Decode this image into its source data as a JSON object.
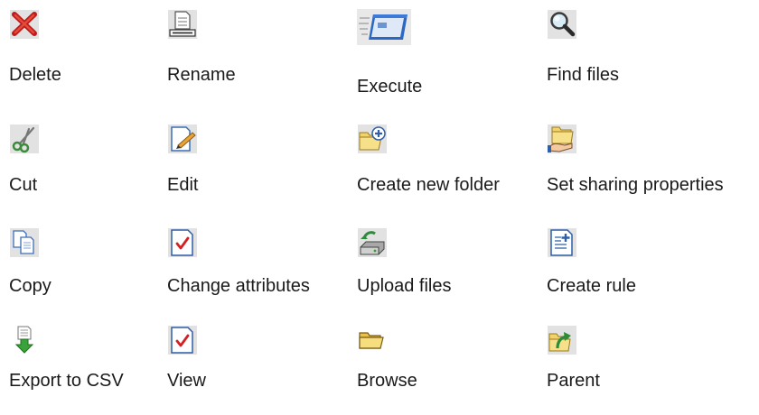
{
  "actions": [
    {
      "label": "Delete",
      "icon": "delete-x-icon"
    },
    {
      "label": "Rename",
      "icon": "rename-document-icon"
    },
    {
      "label": "Execute",
      "icon": "execute-window-icon"
    },
    {
      "label": "Find files",
      "icon": "magnifier-icon"
    },
    {
      "label": "Cut",
      "icon": "scissors-icon"
    },
    {
      "label": "Edit",
      "icon": "edit-pencil-icon"
    },
    {
      "label": "Create new folder",
      "icon": "new-folder-icon"
    },
    {
      "label": "Set sharing properties",
      "icon": "shared-folder-icon"
    },
    {
      "label": "Copy",
      "icon": "copy-pages-icon"
    },
    {
      "label": "Change attributes",
      "icon": "checked-document-icon"
    },
    {
      "label": "Upload files",
      "icon": "upload-drive-icon"
    },
    {
      "label": "Create rule",
      "icon": "rule-document-icon"
    },
    {
      "label": "Export to CSV",
      "icon": "export-arrow-icon"
    },
    {
      "label": "View",
      "icon": "checked-document-icon"
    },
    {
      "label": "Browse",
      "icon": "folder-icon"
    },
    {
      "label": "Parent",
      "icon": "parent-folder-icon"
    }
  ]
}
